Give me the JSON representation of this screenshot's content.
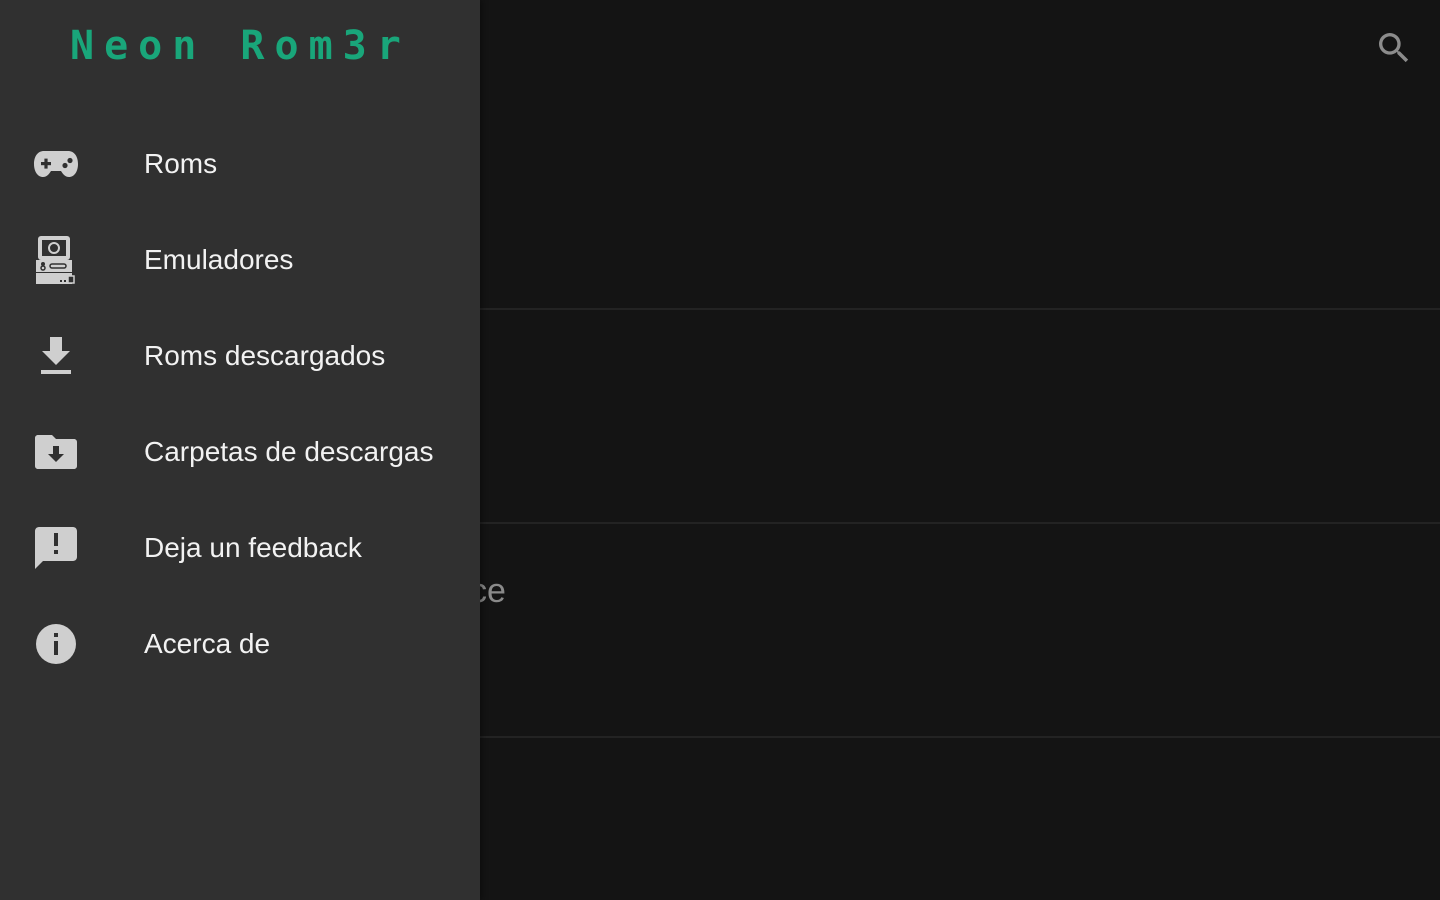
{
  "app": {
    "title": "Neon Rom3r",
    "accent_color": "#19a67a"
  },
  "toolbar": {
    "search_icon": "search-icon"
  },
  "background": {
    "partial_text": "ce"
  },
  "drawer": {
    "items": [
      {
        "label": "Roms",
        "icon": "gamepad-icon"
      },
      {
        "label": "Emuladores",
        "icon": "arcade-cabinet-icon"
      },
      {
        "label": "Roms descargados",
        "icon": "download-icon"
      },
      {
        "label": "Carpetas de descargas",
        "icon": "folder-download-icon"
      },
      {
        "label": "Deja un feedback",
        "icon": "feedback-icon"
      },
      {
        "label": "Acerca de",
        "icon": "info-icon"
      }
    ]
  }
}
